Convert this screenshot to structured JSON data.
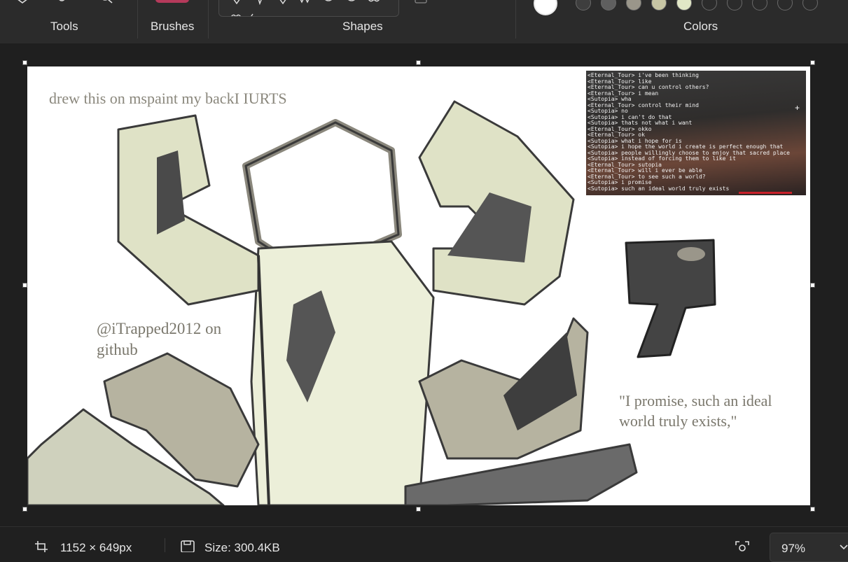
{
  "ribbon": {
    "groups": {
      "tools": "Tools",
      "brushes": "Brushes",
      "shapes": "Shapes",
      "colors": "Colors"
    },
    "brush_color": "#b53a5b",
    "colors": [
      {
        "name": "white",
        "value": "#ffffff",
        "selected": true
      },
      {
        "name": "dark-gray",
        "value": "#3e3e3e"
      },
      {
        "name": "gray",
        "value": "#5f5f5f"
      },
      {
        "name": "warm-gray",
        "value": "#9a968a"
      },
      {
        "name": "khaki",
        "value": "#c7c5a4"
      },
      {
        "name": "pale-green",
        "value": "#e1e7c6"
      },
      {
        "name": "empty-1",
        "value": ""
      },
      {
        "name": "empty-2",
        "value": ""
      },
      {
        "name": "empty-3",
        "value": ""
      },
      {
        "name": "empty-4",
        "value": ""
      },
      {
        "name": "empty-5",
        "value": ""
      }
    ]
  },
  "canvas": {
    "caption_top": "drew this on mspaint my backI IURTS",
    "credit_line1": "@iTrapped2012 on",
    "credit_line2": "github",
    "quote_line1": "\"I promise, such an ideal",
    "quote_line2": "world truly exists,\"",
    "chat_lines": [
      "<Eternal_Tour> i've been thinking",
      "<Eternal_Tour> like",
      "<Eternal_Tour> can u control others?",
      "<Eternal_Tour> i mean",
      "<Sutopia> wha",
      "<Eternal_Tour> control their mind",
      "<Sutopia> no",
      "<Sutopia> i can't do that",
      "<Sutopia> thats not what i want",
      "<Eternal_Tour> okko",
      "<Eternal_Tour> ok",
      "<Sutopia> what i hope for is",
      "<Sutopia> i hope the world i create is perfect enough that",
      "<Sutopia> people willingly choose to enjoy that sacred place",
      "<Sutopia> instead of forcing them to like it",
      "<Eternal_Tour> sutopia",
      "<Eternal_Tour> will i ever be able",
      "<Eternal_Tour> to see such a world?",
      "<Sutopia> i promise",
      "<Sutopia> such an ideal world truly exists"
    ]
  },
  "status": {
    "dimensions": "1152 × 649px",
    "size": "Size: 300.4KB",
    "zoom": "97%"
  }
}
